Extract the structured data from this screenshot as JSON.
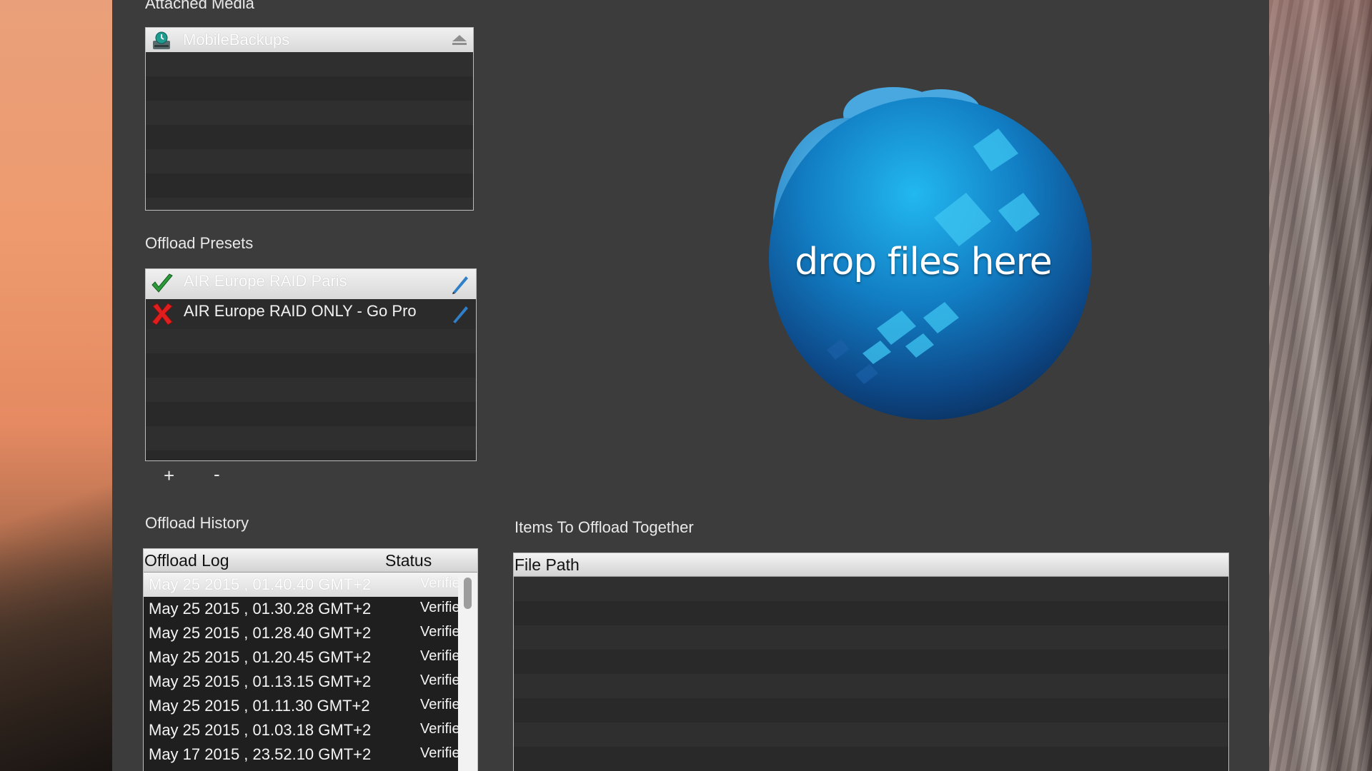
{
  "attached_media": {
    "title": "Attached Media",
    "items": [
      {
        "label": "MobileBackups",
        "icon": "time-machine-disk-icon",
        "selected": true
      }
    ]
  },
  "offload_presets": {
    "title": "Offload Presets",
    "items": [
      {
        "label": "AIR Europe RAID Paris",
        "enabled": true,
        "icon": "checkmark-icon",
        "selected": true
      },
      {
        "label": "AIR Europe RAID ONLY - Go Pro",
        "enabled": false,
        "icon": "red-x-icon",
        "selected": false
      }
    ],
    "add_label": "+",
    "remove_label": "-"
  },
  "drop_zone": {
    "text": "drop files here",
    "accent": "#1fa5e0"
  },
  "offload_history": {
    "title": "Offload History",
    "columns": [
      "Offload Log",
      "Status"
    ],
    "rows": [
      {
        "log": "May 25 2015 , 01.40.40 GMT+2",
        "status": "Verified"
      },
      {
        "log": "May 25 2015 , 01.30.28 GMT+2",
        "status": "Verified"
      },
      {
        "log": "May 25 2015 , 01.28.40 GMT+2",
        "status": "Verified"
      },
      {
        "log": "May 25 2015 , 01.20.45 GMT+2",
        "status": "Verified"
      },
      {
        "log": "May 25 2015 , 01.13.15 GMT+2",
        "status": "Verified"
      },
      {
        "log": "May 25 2015 , 01.11.30 GMT+2",
        "status": "Verified"
      },
      {
        "log": "May 25 2015 , 01.03.18 GMT+2",
        "status": "Verified"
      },
      {
        "log": "May 17 2015 , 23.52.10 GMT+2",
        "status": "Verified"
      }
    ]
  },
  "items_to_offload": {
    "title": "Items To Offload Together",
    "columns": [
      "File Path"
    ]
  }
}
